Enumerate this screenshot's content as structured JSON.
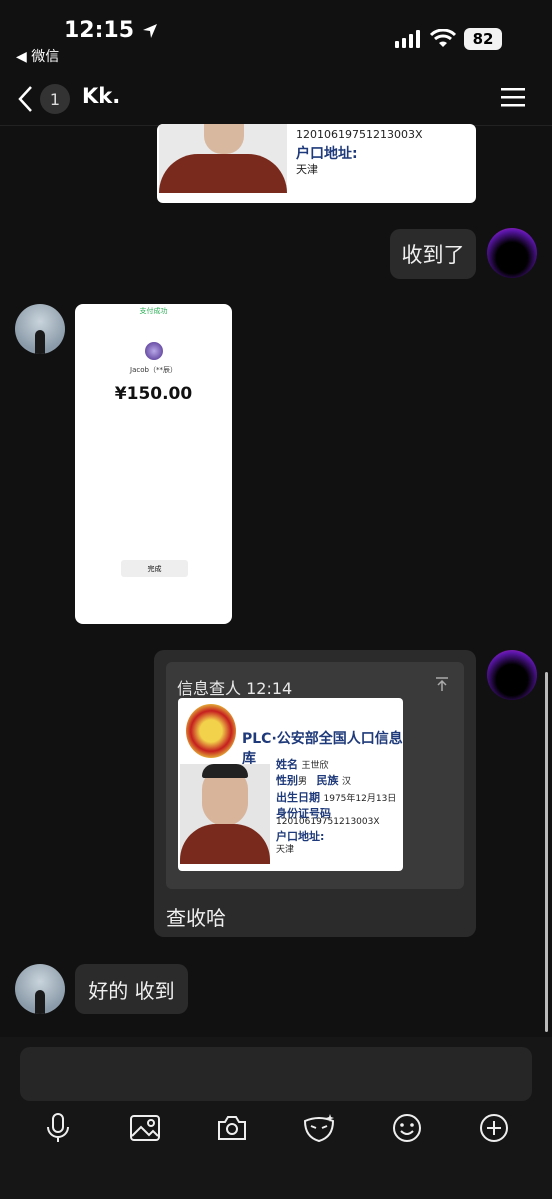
{
  "status": {
    "time": "12:15",
    "back_app": "◀ 微信",
    "battery": "82"
  },
  "header": {
    "unread": "1",
    "title": "Kk."
  },
  "messages": {
    "m1_card": {
      "id": "12010619751213003X",
      "addr_label": "户口地址:",
      "addr": "天津"
    },
    "m2_text": "收到了",
    "m3_pay": {
      "status": "支付成功",
      "name": "Jacob（**辰）",
      "amount": "¥150.00",
      "done": "完成"
    },
    "m4": {
      "header": "信息查人 12:14",
      "card_title": "PLC·公安部全国人口信息库",
      "name_label": "姓名",
      "name": "王世欣",
      "gender_label": "性别",
      "gender": "男",
      "ethnic_label": "民族",
      "ethnic": "汉",
      "dob_label": "出生日期",
      "dob": "1975年12月13日",
      "id_label": "身份证号码",
      "id": "12010619751213003X",
      "addr_label": "户口地址:",
      "addr": "天津",
      "caption": "查收哈"
    },
    "m5_text": "好的 收到"
  },
  "icons": [
    "location-arrow-icon",
    "signal-icon",
    "wifi-icon",
    "back-chevron-icon",
    "menu-icon",
    "mic-icon",
    "image-icon",
    "camera-icon",
    "mask-icon",
    "emoji-icon",
    "plus-icon",
    "pin-top-icon"
  ]
}
